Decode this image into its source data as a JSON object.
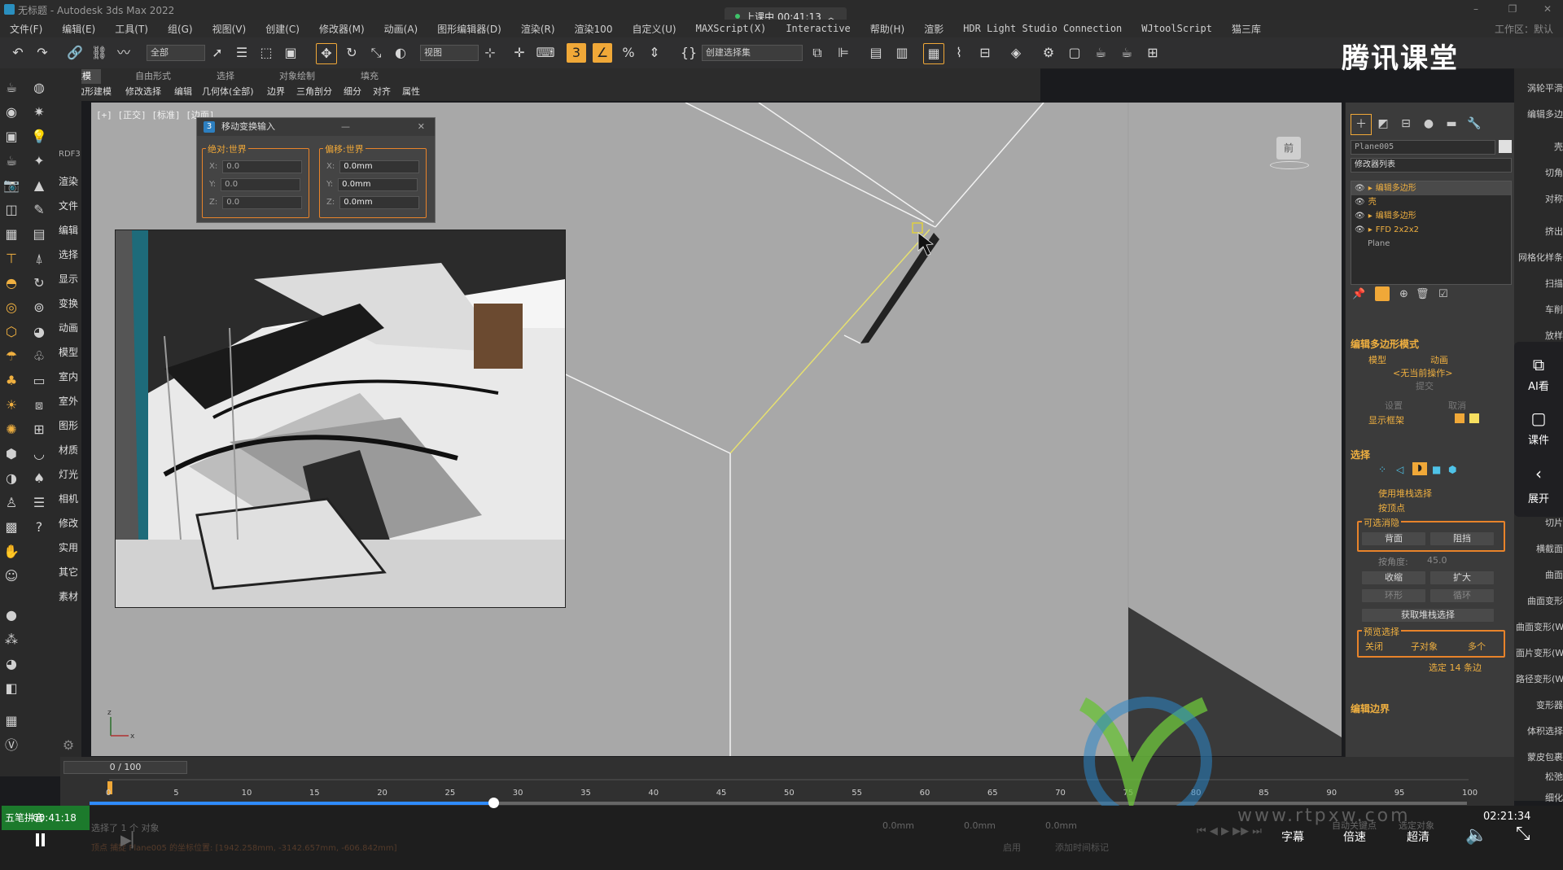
{
  "window": {
    "title": "无标题 - Autodesk 3ds Max 2022",
    "class_timer": "上课中 00:41:13",
    "workspace_label": "工作区：默认"
  },
  "menu": [
    "文件(F)",
    "编辑(E)",
    "工具(T)",
    "组(G)",
    "视图(V)",
    "创建(C)",
    "修改器(M)",
    "动画(A)",
    "图形编辑器(D)",
    "渲染(R)",
    "渲染100",
    "自定义(U)",
    "MAXScript(X)",
    "Interactive",
    "帮助(H)",
    "渲影",
    "HDR Light Studio Connection",
    "WJtoolScript",
    "猫三库"
  ],
  "toolbar": {
    "select_filter": "全部",
    "ref_coord": "视图",
    "named_selection": "创建选择集"
  },
  "ribbon": {
    "tabs": [
      "建模",
      "自由形式",
      "选择",
      "对象绘制",
      "填充"
    ],
    "items": [
      "多边形建模",
      "修改选择",
      "编辑",
      "几何体(全部)",
      "边界",
      "三角剖分",
      "细分",
      "对齐",
      "属性"
    ]
  },
  "left_labels": [
    "RDF3",
    "渲染",
    "文件",
    "编辑",
    "选择",
    "显示",
    "变换",
    "动画",
    "模型",
    "室内",
    "室外",
    "图形",
    "材质",
    "灯光",
    "相机",
    "修改",
    "实用",
    "其它",
    "素材"
  ],
  "viewport": {
    "label": "[+] [正交] [标准] [边面]",
    "viewcube_face": "前"
  },
  "dialog": {
    "title": "移动变换输入",
    "abs_group": "绝对:世界",
    "offset_group": "偏移:世界",
    "abs_values": {
      "x": "0.0",
      "y": "0.0",
      "z": "0.0"
    },
    "offset_values": {
      "x": "0.0mm",
      "y": "0.0mm",
      "z": "0.0mm"
    },
    "axis_labels": [
      "X:",
      "Y:",
      "Z:"
    ]
  },
  "command_panel": {
    "object_name": "Plane005",
    "modifier_list": "修改器列表",
    "stack": [
      "编辑多边形",
      "壳",
      "编辑多边形",
      "FFD 2x2x2",
      "Plane"
    ],
    "poly_mode_title": "编辑多边形模式",
    "mode_model": "模型",
    "mode_anim": "动画",
    "no_op": "<无当前操作>",
    "commit": "提交",
    "settings": "设置",
    "cancel": "取消",
    "show_cage": "显示框架",
    "selection_title": "选择",
    "use_stack_sel": "使用堆栈选择",
    "by_vertex": "按顶点",
    "ignore_title": "可选消隐",
    "backface": "背面",
    "occluded": "阻挡",
    "by_angle": "按角度:",
    "angle_value": "45.0",
    "shrink": "收缩",
    "grow": "扩大",
    "ring": "环形",
    "loop": "循环",
    "get_stack_sel": "获取堆栈选择",
    "preview_title": "预览选择",
    "preview_off": "关闭",
    "preview_subobj": "子对象",
    "preview_multi": "多个",
    "selected_info": "选定 14 条边",
    "edit_border_title": "编辑边界"
  },
  "far_right_labels": [
    "涡轮平滑",
    "编辑多边",
    "壳",
    "切角",
    "对称",
    "挤出",
    "网格化样条",
    "扫描",
    "车削",
    "放样",
    "切片",
    "横截面",
    "曲面",
    "曲面变形",
    "曲面变形(W)",
    "面片变形(W)",
    "路径变形(W)",
    "变形器",
    "体积选择",
    "蒙皮包裹",
    "松弛",
    "细化"
  ],
  "side_buttons": [
    "AI看",
    "课件",
    "展开"
  ],
  "timeline": {
    "frame": "0 / 100",
    "ticks": [
      "0",
      "5",
      "10",
      "15",
      "20",
      "25",
      "30",
      "35",
      "40",
      "45",
      "50",
      "55",
      "60",
      "65",
      "70",
      "75",
      "80",
      "85",
      "90",
      "95",
      "100"
    ]
  },
  "status": {
    "selected": "选择了 1 个 对象",
    "hint": "顶点 捕捉 Plane005 的坐标位置: [1942.258mm, -3142.657mm, -606.842mm]",
    "coord_x": "0.0mm",
    "coord_y": "0.0mm",
    "coord_z": "0.0mm",
    "enable": "启用",
    "add_time_tag": "添加时间标记",
    "auto_key": "自动关键点",
    "selected_obj": "选定对象"
  },
  "player": {
    "elapsed": "00:41:18",
    "total": "02:21:34",
    "progress": 0.293,
    "subtitle": "字幕",
    "speed": "倍速",
    "quality": "超清",
    "ime": "五笔拼音"
  },
  "watermark": {
    "brand": "腾讯课堂",
    "site": "www.rtpxw.com"
  }
}
